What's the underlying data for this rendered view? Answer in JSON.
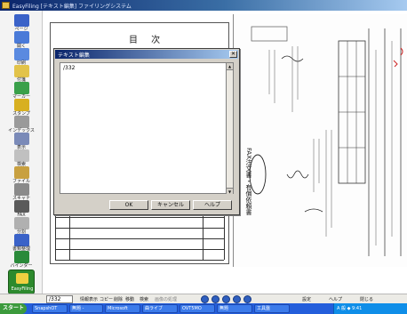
{
  "window": {
    "title": "EasyFiling [テキスト編集] ファイリングシステム"
  },
  "toolbar": {
    "items": [
      {
        "label": "ページ",
        "color": "#3a62c8"
      },
      {
        "label": "開く",
        "color": "#4a7ad8"
      },
      {
        "label": "印刷",
        "color": "#5a8ae0"
      },
      {
        "label": "付箋",
        "color": "#e2c34a"
      },
      {
        "label": "マーカー",
        "color": "#3aa04a"
      },
      {
        "label": "スタンプ",
        "color": "#d8b020"
      },
      {
        "label": "インデックス",
        "color": "#9a9a9a"
      },
      {
        "label": "表示",
        "color": "#7a8ab8"
      },
      {
        "label": "検索",
        "color": "#c0c0c0"
      },
      {
        "label": "ファイル",
        "color": "#c8a040"
      },
      {
        "label": "スキャナ",
        "color": "#8a8a8a"
      },
      {
        "label": "FAX",
        "color": "#5a5a5a"
      },
      {
        "label": "分割",
        "color": "#b0b0b0"
      },
      {
        "label": "書類整理",
        "color": "#3a62c8"
      },
      {
        "label": "バインダー",
        "color": "#2a8a3a"
      }
    ],
    "logo_label": "EasyFiling"
  },
  "toc": {
    "title": "目 次"
  },
  "fax": {
    "headline": "FAX注文書・有償依頼書"
  },
  "dialog": {
    "title": "テキスト編集",
    "text": "/332",
    "ok_label": "OK",
    "cancel_label": "キャンセル",
    "help_label": "ヘルプ"
  },
  "statusbar": {
    "page_value": "/332",
    "items": [
      "情報表示",
      "コピー",
      "削除",
      "移動",
      "検索",
      "画像の処理"
    ],
    "right_items": [
      "設定",
      "ヘルプ",
      "閉じる"
    ]
  },
  "taskbar": {
    "start_label": "スタート",
    "tasks": [
      "SnapshOT",
      "無題 -",
      "Microsoft",
      "曲ライブ",
      "OVT5MO",
      "無題",
      "工具盤"
    ],
    "tray_time": "A 般 ◆ 9:41"
  }
}
